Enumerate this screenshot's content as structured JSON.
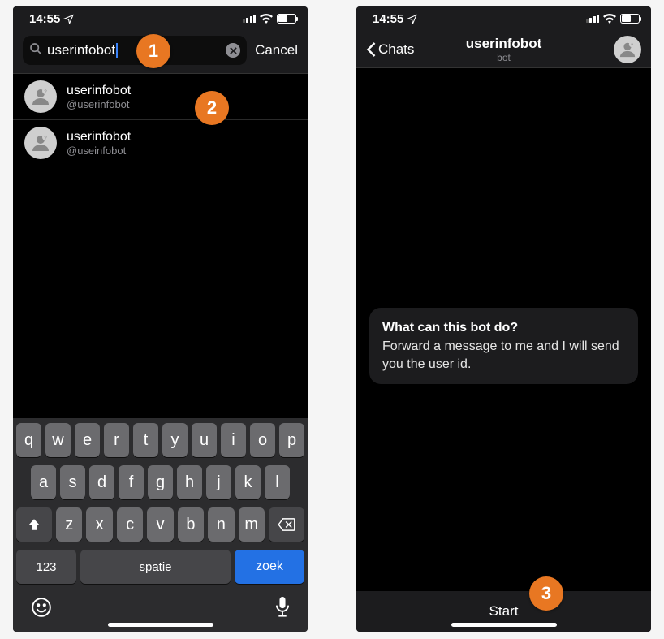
{
  "status": {
    "time": "14:55"
  },
  "markers": {
    "m1": "1",
    "m2": "2",
    "m3": "3"
  },
  "left": {
    "search_value": "userinfobot",
    "cancel_label": "Cancel",
    "results": [
      {
        "name": "userinfobot",
        "handle": "@userinfobot"
      },
      {
        "name": "userinfobot",
        "handle": "@useinfobot"
      }
    ],
    "keyboard": {
      "row1": [
        "q",
        "w",
        "e",
        "r",
        "t",
        "y",
        "u",
        "i",
        "o",
        "p"
      ],
      "row2": [
        "a",
        "s",
        "d",
        "f",
        "g",
        "h",
        "j",
        "k",
        "l"
      ],
      "row3": [
        "z",
        "x",
        "c",
        "v",
        "b",
        "n",
        "m"
      ],
      "num_label": "123",
      "space_label": "spatie",
      "search_label": "zoek"
    }
  },
  "right": {
    "back_label": "Chats",
    "title": "userinfobot",
    "subtitle": "bot",
    "bubble_heading": "What can this bot do?",
    "bubble_body": "Forward a message to me and I will send you the user id.",
    "start_label": "Start"
  }
}
